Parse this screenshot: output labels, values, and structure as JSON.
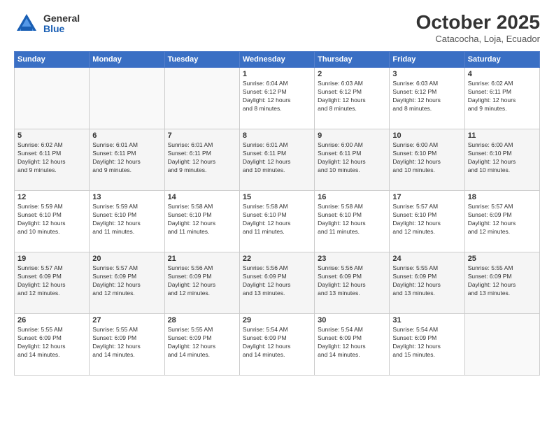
{
  "header": {
    "logo": {
      "general": "General",
      "blue": "Blue"
    },
    "title": "October 2025",
    "location": "Catacocha, Loja, Ecuador"
  },
  "weekdays": [
    "Sunday",
    "Monday",
    "Tuesday",
    "Wednesday",
    "Thursday",
    "Friday",
    "Saturday"
  ],
  "weeks": [
    [
      {
        "day": "",
        "info": ""
      },
      {
        "day": "",
        "info": ""
      },
      {
        "day": "",
        "info": ""
      },
      {
        "day": "1",
        "info": "Sunrise: 6:04 AM\nSunset: 6:12 PM\nDaylight: 12 hours\nand 8 minutes."
      },
      {
        "day": "2",
        "info": "Sunrise: 6:03 AM\nSunset: 6:12 PM\nDaylight: 12 hours\nand 8 minutes."
      },
      {
        "day": "3",
        "info": "Sunrise: 6:03 AM\nSunset: 6:12 PM\nDaylight: 12 hours\nand 8 minutes."
      },
      {
        "day": "4",
        "info": "Sunrise: 6:02 AM\nSunset: 6:11 PM\nDaylight: 12 hours\nand 9 minutes."
      }
    ],
    [
      {
        "day": "5",
        "info": "Sunrise: 6:02 AM\nSunset: 6:11 PM\nDaylight: 12 hours\nand 9 minutes."
      },
      {
        "day": "6",
        "info": "Sunrise: 6:01 AM\nSunset: 6:11 PM\nDaylight: 12 hours\nand 9 minutes."
      },
      {
        "day": "7",
        "info": "Sunrise: 6:01 AM\nSunset: 6:11 PM\nDaylight: 12 hours\nand 9 minutes."
      },
      {
        "day": "8",
        "info": "Sunrise: 6:01 AM\nSunset: 6:11 PM\nDaylight: 12 hours\nand 10 minutes."
      },
      {
        "day": "9",
        "info": "Sunrise: 6:00 AM\nSunset: 6:11 PM\nDaylight: 12 hours\nand 10 minutes."
      },
      {
        "day": "10",
        "info": "Sunrise: 6:00 AM\nSunset: 6:10 PM\nDaylight: 12 hours\nand 10 minutes."
      },
      {
        "day": "11",
        "info": "Sunrise: 6:00 AM\nSunset: 6:10 PM\nDaylight: 12 hours\nand 10 minutes."
      }
    ],
    [
      {
        "day": "12",
        "info": "Sunrise: 5:59 AM\nSunset: 6:10 PM\nDaylight: 12 hours\nand 10 minutes."
      },
      {
        "day": "13",
        "info": "Sunrise: 5:59 AM\nSunset: 6:10 PM\nDaylight: 12 hours\nand 11 minutes."
      },
      {
        "day": "14",
        "info": "Sunrise: 5:58 AM\nSunset: 6:10 PM\nDaylight: 12 hours\nand 11 minutes."
      },
      {
        "day": "15",
        "info": "Sunrise: 5:58 AM\nSunset: 6:10 PM\nDaylight: 12 hours\nand 11 minutes."
      },
      {
        "day": "16",
        "info": "Sunrise: 5:58 AM\nSunset: 6:10 PM\nDaylight: 12 hours\nand 11 minutes."
      },
      {
        "day": "17",
        "info": "Sunrise: 5:57 AM\nSunset: 6:10 PM\nDaylight: 12 hours\nand 12 minutes."
      },
      {
        "day": "18",
        "info": "Sunrise: 5:57 AM\nSunset: 6:09 PM\nDaylight: 12 hours\nand 12 minutes."
      }
    ],
    [
      {
        "day": "19",
        "info": "Sunrise: 5:57 AM\nSunset: 6:09 PM\nDaylight: 12 hours\nand 12 minutes."
      },
      {
        "day": "20",
        "info": "Sunrise: 5:57 AM\nSunset: 6:09 PM\nDaylight: 12 hours\nand 12 minutes."
      },
      {
        "day": "21",
        "info": "Sunrise: 5:56 AM\nSunset: 6:09 PM\nDaylight: 12 hours\nand 12 minutes."
      },
      {
        "day": "22",
        "info": "Sunrise: 5:56 AM\nSunset: 6:09 PM\nDaylight: 12 hours\nand 13 minutes."
      },
      {
        "day": "23",
        "info": "Sunrise: 5:56 AM\nSunset: 6:09 PM\nDaylight: 12 hours\nand 13 minutes."
      },
      {
        "day": "24",
        "info": "Sunrise: 5:55 AM\nSunset: 6:09 PM\nDaylight: 12 hours\nand 13 minutes."
      },
      {
        "day": "25",
        "info": "Sunrise: 5:55 AM\nSunset: 6:09 PM\nDaylight: 12 hours\nand 13 minutes."
      }
    ],
    [
      {
        "day": "26",
        "info": "Sunrise: 5:55 AM\nSunset: 6:09 PM\nDaylight: 12 hours\nand 14 minutes."
      },
      {
        "day": "27",
        "info": "Sunrise: 5:55 AM\nSunset: 6:09 PM\nDaylight: 12 hours\nand 14 minutes."
      },
      {
        "day": "28",
        "info": "Sunrise: 5:55 AM\nSunset: 6:09 PM\nDaylight: 12 hours\nand 14 minutes."
      },
      {
        "day": "29",
        "info": "Sunrise: 5:54 AM\nSunset: 6:09 PM\nDaylight: 12 hours\nand 14 minutes."
      },
      {
        "day": "30",
        "info": "Sunrise: 5:54 AM\nSunset: 6:09 PM\nDaylight: 12 hours\nand 14 minutes."
      },
      {
        "day": "31",
        "info": "Sunrise: 5:54 AM\nSunset: 6:09 PM\nDaylight: 12 hours\nand 15 minutes."
      },
      {
        "day": "",
        "info": ""
      }
    ]
  ]
}
